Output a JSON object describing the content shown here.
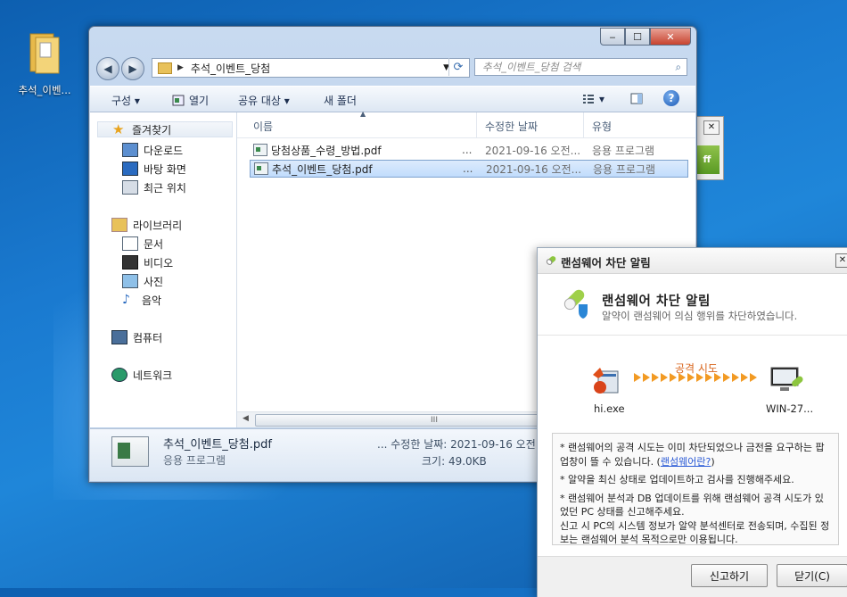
{
  "desktop": {
    "icon_label": "추석_이벤..."
  },
  "explorer": {
    "caption_buttons": {
      "minimize": "‒",
      "maximize": "☐",
      "close": "✕"
    },
    "address_path": "추석_이벤트_당첨",
    "search_placeholder": "추석_이벤트_당첨 검색",
    "toolbar": {
      "organize": "구성 ▾",
      "open": "열기",
      "share": "공유 대상 ▾",
      "new_folder": "새 폴더",
      "view_menu": "▾",
      "help": "?"
    },
    "nav": {
      "favorites": "즐겨찾기",
      "downloads": "다운로드",
      "desktop": "바탕 화면",
      "recent": "최근 위치",
      "libraries": "라이브러리",
      "documents": "문서",
      "videos": "비디오",
      "pictures": "사진",
      "music": "음악",
      "computer": "컴퓨터",
      "network": "네트워크"
    },
    "columns": {
      "name": "이름",
      "modified": "수정한 날짜",
      "type": "유형"
    },
    "files": [
      {
        "name": "당첨상품_수령_방법.pdf",
        "dots": "...",
        "date": "2021-09-16 오전...",
        "type": "응용 프로그램",
        "selected": false
      },
      {
        "name": "추석_이벤트_당첨.pdf",
        "dots": "...",
        "date": "2021-09-16 오전...",
        "type": "응용 프로그램",
        "selected": true
      }
    ],
    "scroll_glyph": "III",
    "details": {
      "name": "추석_이벤트_당첨.pdf",
      "type": "응용 프로그램",
      "modified": "... 수정한 날짜: 2021-09-16 오전",
      "size": "크기: 49.0KB"
    }
  },
  "background_window": {
    "close": "✕",
    "badge": "ff"
  },
  "alert": {
    "title": "랜섬웨어 차단 알림",
    "close": "✕",
    "heading": "랜섬웨어 차단 알림",
    "subheading": "알약이 랜섬웨어 의심 행위를 차단하였습니다.",
    "attack_label": "공격 시도",
    "source_label": "hi.exe",
    "target_label": "WIN-27...",
    "note1_before": "* 랜섬웨어의 공격 시도는 이미 차단되었으나 금전을 요구하는 팝업창이 뜰 수 있습니다. (",
    "note1_link": "랜섬웨어란?",
    "note1_after": ")",
    "note2": "* 알약을 최신 상태로 업데이트하고 검사를 진행해주세요.",
    "note3a": "* 랜섬웨어 분석과 DB 업데이트를 위해 랜섬웨어 공격 시도가 있었던 PC 상태를 신고해주세요.",
    "note3b": "신고 시 PC의 시스템 정보가 알약 분석센터로 전송되며, 수집된 정보는 랜섬웨어 분석 목적으로만 이용됩니다.",
    "report_button": "신고하기",
    "close_button": "닫기(C)"
  }
}
